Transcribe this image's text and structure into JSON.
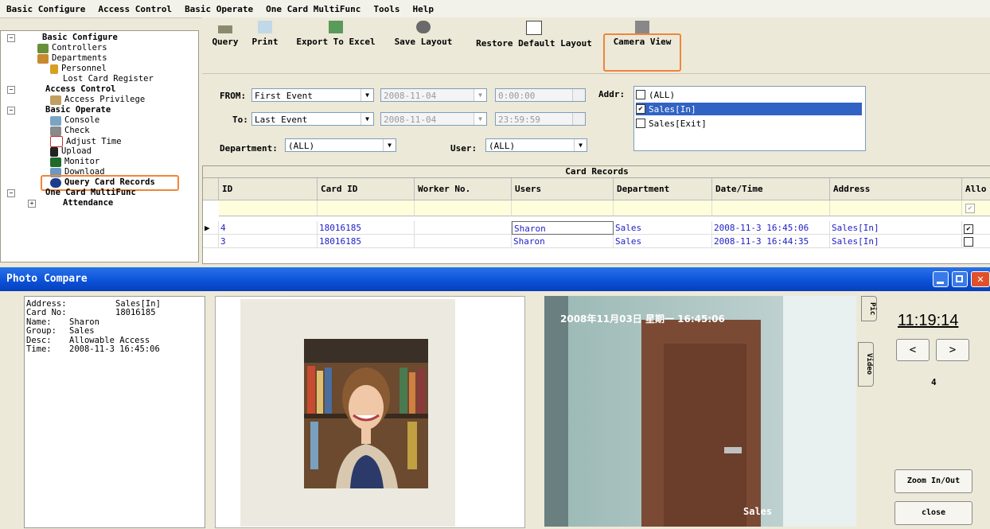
{
  "menu": [
    "Basic Configure",
    "Access Control",
    "Basic Operate",
    "One Card MultiFunc",
    "Tools",
    "Help"
  ],
  "tree": {
    "basic_configure": "Basic Configure",
    "controllers": "Controllers",
    "departments": "Departments",
    "personnel": "Personnel",
    "lost_card": "Lost Card Register",
    "access_control": "Access Control",
    "access_privilege": "Access Privilege",
    "basic_operate": "Basic Operate",
    "console": "Console",
    "check": "Check",
    "adjust_time": "Adjust Time",
    "upload": "Upload",
    "monitor": "Monitor",
    "download": "Download",
    "query_card_records": "Query Card Records",
    "one_card": "One Card MultiFunc",
    "attendance": "Attendance"
  },
  "toolbar": {
    "query": "Query",
    "print": "Print",
    "export": "Export To Excel",
    "save_layout": "Save Layout",
    "restore_layout": "Restore Default Layout",
    "camera_view": "Camera View"
  },
  "filters": {
    "from_label": "FROM:",
    "from_value": "First Event",
    "from_date": "2008-11-04",
    "from_time": "0:00:00",
    "to_label": "To:",
    "to_value": "Last Event",
    "to_date": "2008-11-04",
    "to_time": "23:59:59",
    "department_label": "Department:",
    "department_value": "(ALL)",
    "user_label": "User:",
    "user_value": "(ALL)",
    "addr_label": "Addr:",
    "addr_items": [
      {
        "label": "(ALL)",
        "checked": false
      },
      {
        "label": "Sales[In]",
        "checked": true
      },
      {
        "label": "Sales[Exit]",
        "checked": false
      }
    ]
  },
  "grid": {
    "title": "Card Records",
    "columns": [
      "ID",
      "Card ID",
      "Worker No.",
      "Users",
      "Department",
      "Date/Time",
      "Address",
      "Allo"
    ],
    "rows": [
      {
        "id": "4",
        "card_id": "18016185",
        "worker": "",
        "user": "Sharon",
        "dept": "Sales",
        "datetime": "2008-11-3 16:45:06",
        "address": "Sales[In]",
        "allow": "✔"
      },
      {
        "id": "3",
        "card_id": "18016185",
        "worker": "",
        "user": "Sharon",
        "dept": "Sales",
        "datetime": "2008-11-3 16:44:35",
        "address": "Sales[In]",
        "allow": ""
      }
    ]
  },
  "photo_compare": {
    "title": "Photo Compare",
    "info": {
      "address_label": "Address:",
      "address": "Sales[In]",
      "card_label": "Card No:",
      "card": "18016185",
      "name_label": "Name:",
      "name": "Sharon",
      "group_label": "Group:",
      "group": "Sales",
      "desc_label": "Desc:",
      "desc": "Allowable Access",
      "time_label": "Time:",
      "time": "2008-11-3 16:45:06"
    },
    "camera_overlay": "2008年11月03日 星期一 16:45:06",
    "camera_caption": "Sales",
    "tab_pic": "Pic",
    "tab_video": "Video",
    "clock": "11:19:14",
    "prev": "<",
    "next": ">",
    "count": "4",
    "zoom": "Zoom In/Out",
    "close": "close"
  },
  "colors": {
    "accent": "#f0853a",
    "titlebar": "#0a50d8",
    "selection": "#3163c5",
    "link": "#2020c8"
  }
}
